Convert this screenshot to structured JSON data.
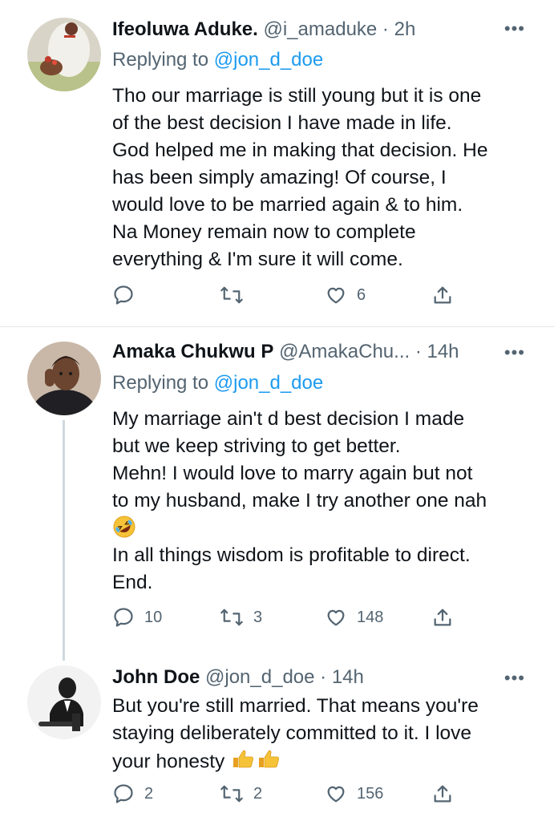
{
  "tweets": [
    {
      "name": "Ifeoluwa Aduke.",
      "handle": "@i_amaduke",
      "dot": " · ",
      "time": "2h",
      "replying_label": "Replying to",
      "replying_to": "@jon_d_doe",
      "lines": [
        "Tho our marriage is still young but it is one",
        "of the best decision I have made in life.",
        "God helped me in making that decision. He",
        "has been simply amazing! Of course, I",
        "would love to be married again & to him.",
        "Na Money remain now to complete",
        "everything & I'm sure it will come."
      ],
      "stats": {
        "replies": "",
        "retweets": "",
        "likes": "6"
      }
    },
    {
      "name": "Amaka Chukwu P",
      "handle": "@AmakaChu...",
      "dot": " · ",
      "time": "14h",
      "replying_label": "Replying to",
      "replying_to": "@jon_d_doe",
      "lines": [
        "My marriage ain't d best decision I made",
        "but we keep striving to get better.",
        "Mehn! I would love to marry again but not",
        "to my husband, make I try another one nah",
        "",
        "In all things wisdom is profitable to direct.",
        "End."
      ],
      "emoji": "rolling-on-the-floor-laughing-emoji",
      "stats": {
        "replies": "10",
        "retweets": "3",
        "likes": "148"
      }
    },
    {
      "name": "John Doe",
      "handle": "@jon_d_doe",
      "dot": " · ",
      "time": "14h",
      "lines": [
        "But you're still married. That means you're",
        "staying deliberately committed to it. I love",
        "your honesty"
      ],
      "emoji": "thumbs-up-emoji",
      "stats": {
        "replies": "2",
        "retweets": "2",
        "likes": "156"
      }
    }
  ],
  "colors": {
    "accent": "#1d9bf0",
    "muted": "#536471",
    "text": "#0f1419",
    "divider": "#e4e6e8"
  },
  "icons": [
    "reply-icon",
    "retweet-icon",
    "like-icon",
    "share-icon",
    "more-icon"
  ]
}
